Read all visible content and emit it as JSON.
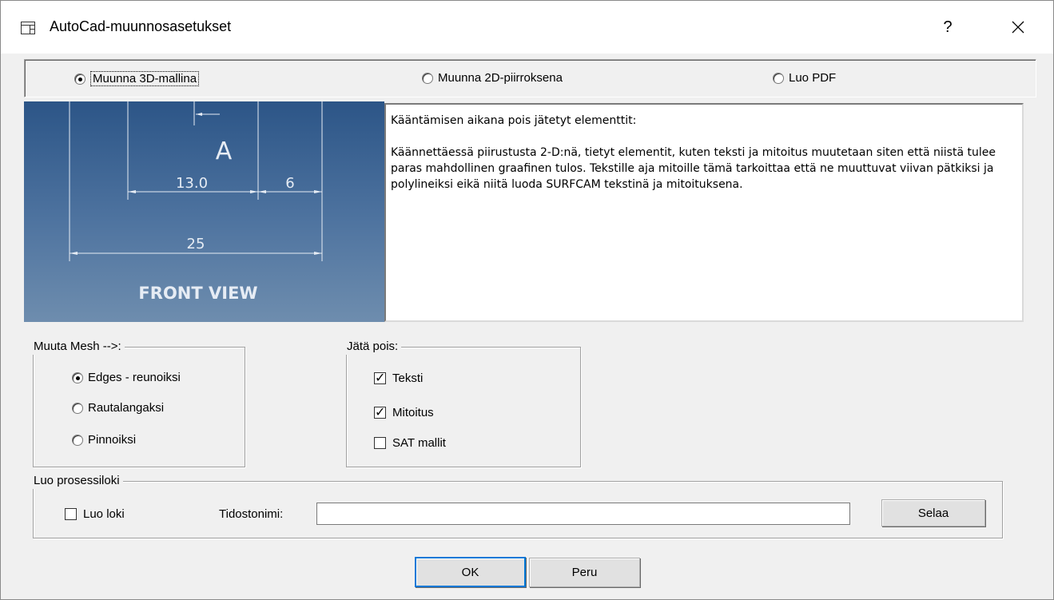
{
  "window": {
    "title": "AutoCad-muunnosasetukset",
    "help_label": "?",
    "close_label": "✕"
  },
  "modes": [
    {
      "label": "Muunna 3D-mallina",
      "selected": true
    },
    {
      "label": "Muunna 2D-piirroksena",
      "selected": false
    },
    {
      "label": "Luo PDF",
      "selected": false
    }
  ],
  "preview": {
    "dim_a": "A",
    "dim_13": "13.0",
    "dim_6": "6",
    "dim_25": "25",
    "caption": "FRONT VIEW"
  },
  "description": {
    "heading": "Kääntämisen aikana pois jätetyt elementtit:",
    "body": "Käännettäessä piirustusta 2-D:nä, tietyt elementit, kuten teksti ja mitoitus muutetaan siten että niistä tulee paras mahdollinen graafinen tulos. Tekstille aja mitoille tämä tarkoittaa että ne muuttuvat viivan pätkiksi ja polylineiksi eikä niitä luoda SURFCAM tekstinä ja mitoituksena."
  },
  "mesh_group": {
    "title": "Muuta Mesh -->:",
    "options": [
      {
        "label": "Edges - reunoiksi",
        "selected": true
      },
      {
        "label": "Rautalangaksi",
        "selected": false
      },
      {
        "label": "Pinnoiksi",
        "selected": false
      }
    ]
  },
  "exclude_group": {
    "title": "Jätä pois:",
    "options": [
      {
        "label": "Teksti",
        "checked": true
      },
      {
        "label": "Mitoitus",
        "checked": true
      },
      {
        "label": "SAT mallit",
        "checked": false
      }
    ]
  },
  "log_group": {
    "title": "Luo prosessiloki",
    "create_log_label": "Luo loki",
    "create_log_checked": false,
    "filename_label": "Tidostonimi:",
    "filename_value": "",
    "browse_label": "Selaa"
  },
  "buttons": {
    "ok": "OK",
    "cancel": "Peru"
  }
}
